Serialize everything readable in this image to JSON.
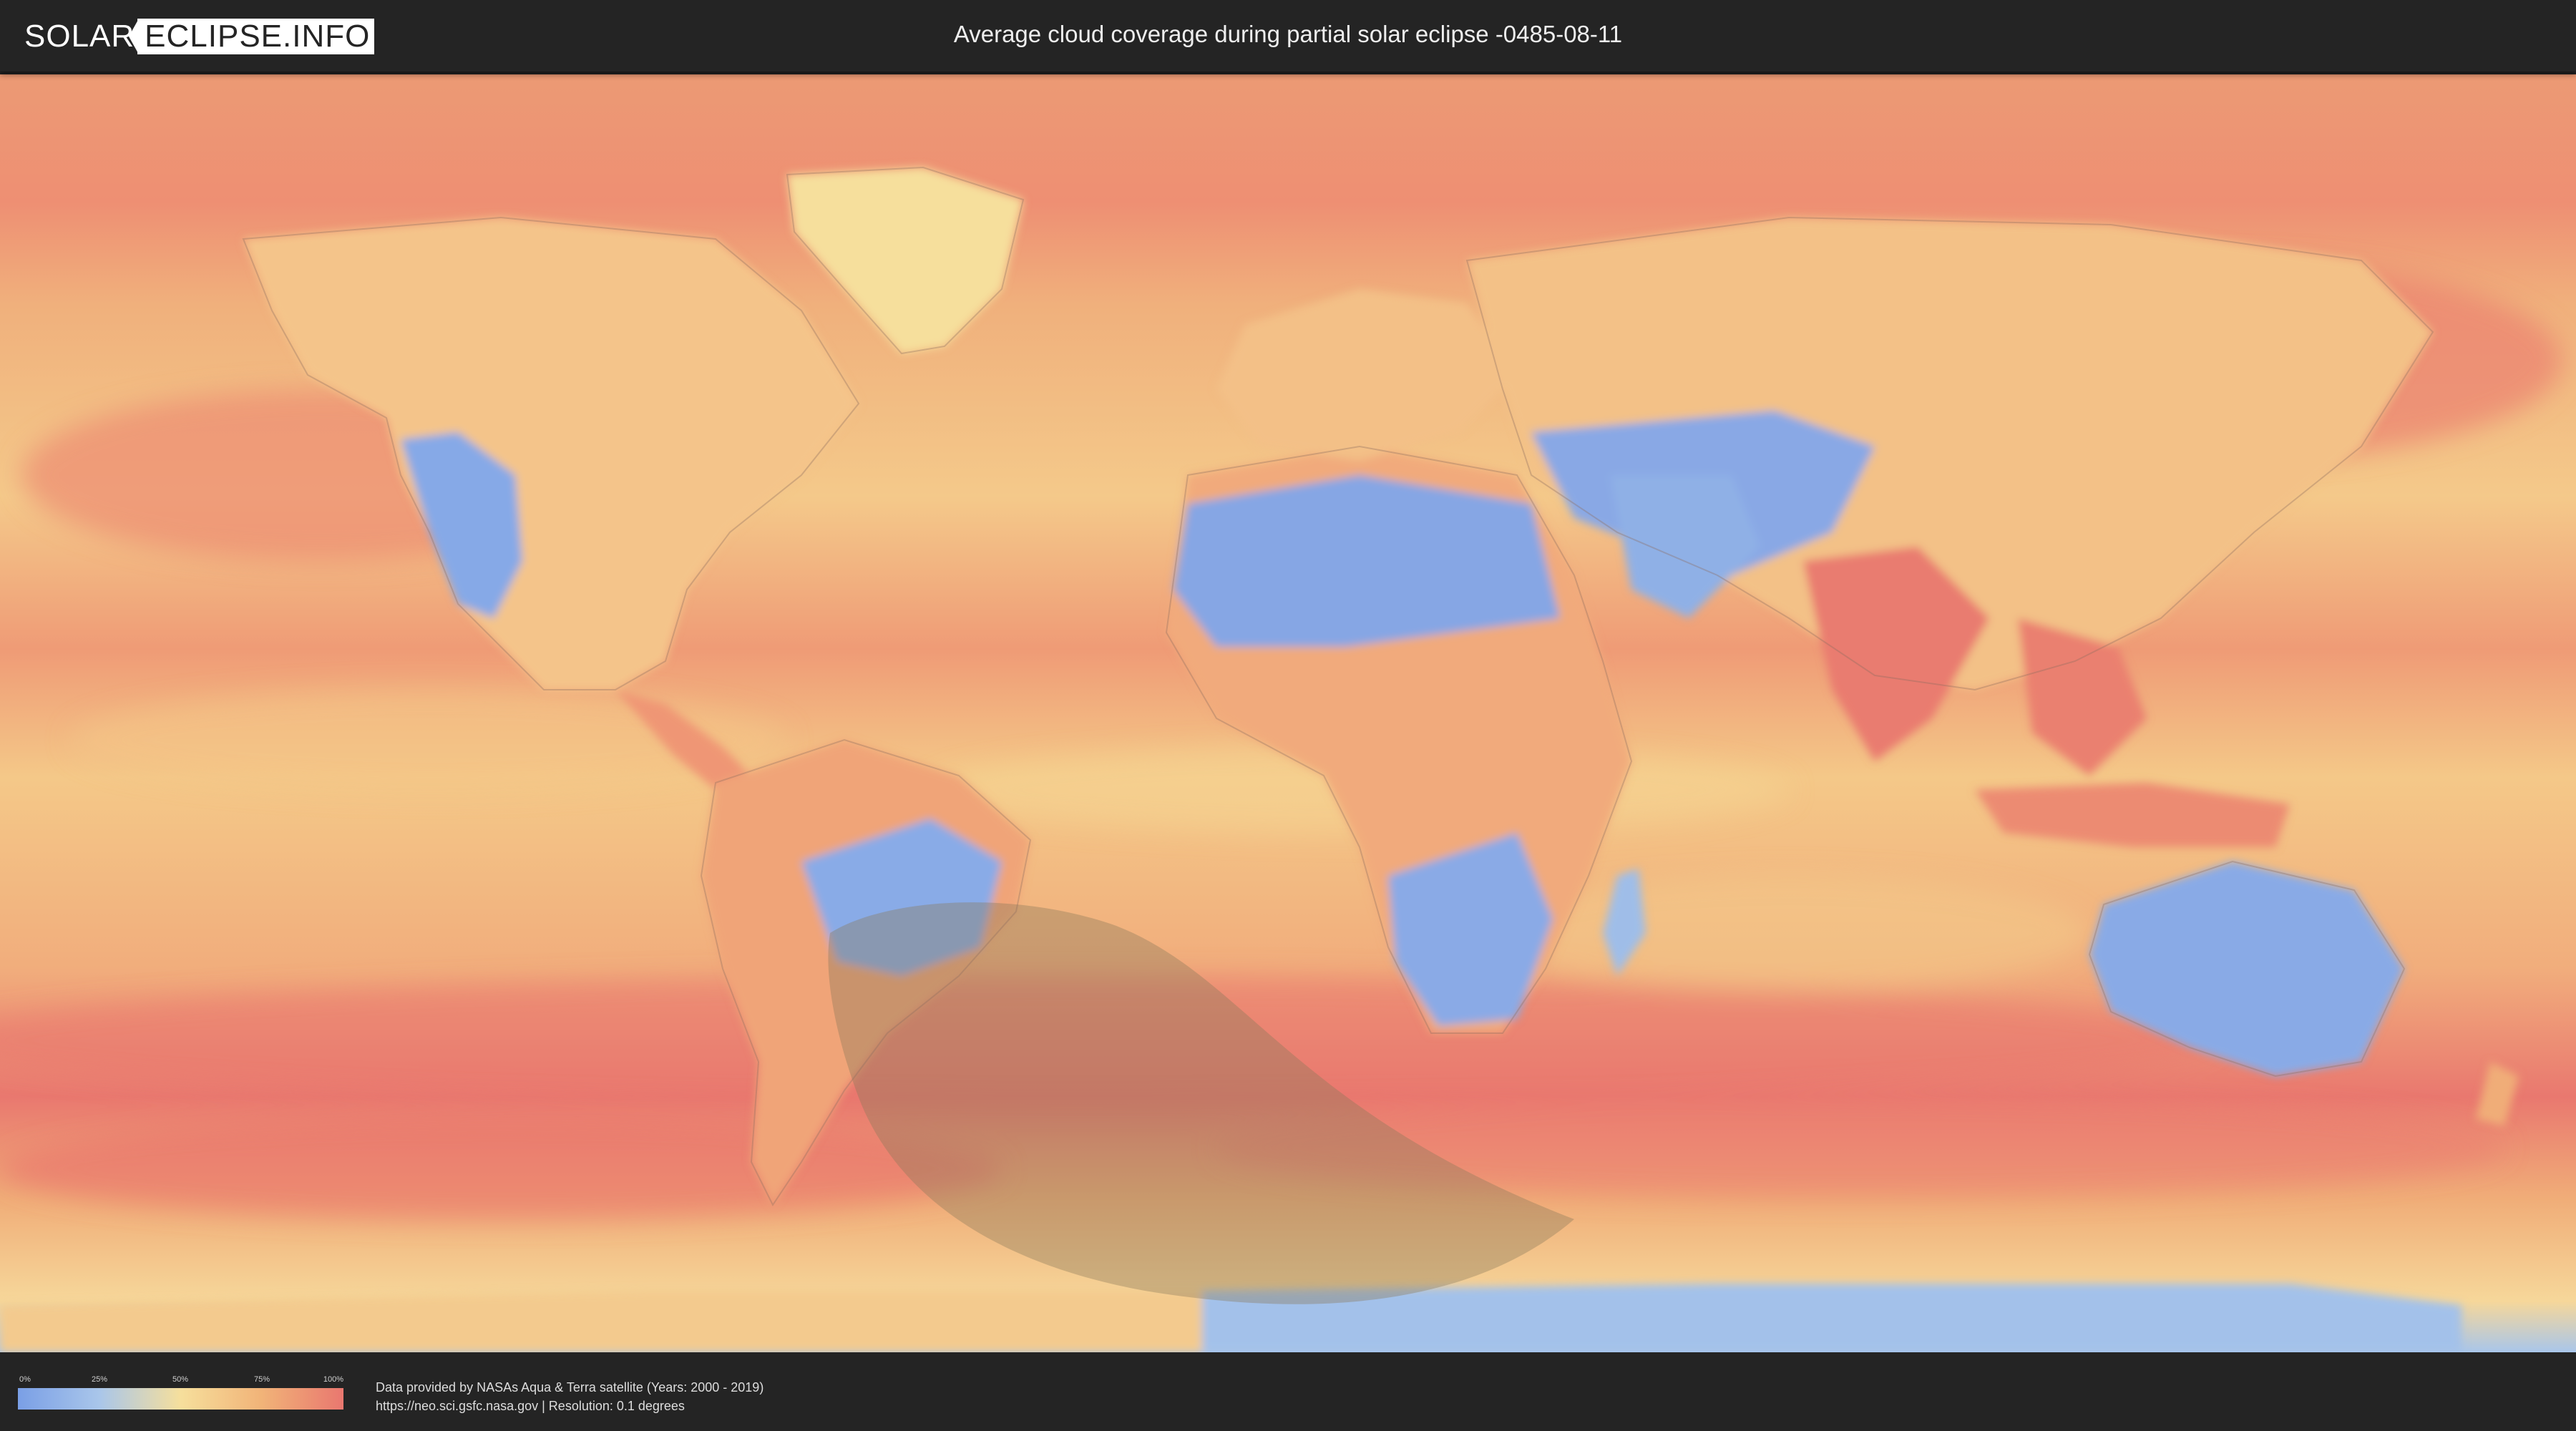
{
  "header": {
    "logo_left": "SOLAR",
    "logo_right": "ECLIPSE.INFO",
    "title": "Average cloud coverage during partial solar eclipse -0485-08-11"
  },
  "map": {
    "icon": "world-map-cloud-coverage",
    "colors": {
      "clear": "#7a9fe6",
      "low": "#a9c6ea",
      "mid": "#f6df9c",
      "high": "#f1b378",
      "overcast": "#e9776f",
      "eclipse_shadow": "#8a7a5a"
    }
  },
  "legend": {
    "ticks": [
      "0%",
      "25%",
      "50%",
      "75%",
      "100%"
    ],
    "colors": [
      "#7a9fe6",
      "#a9c6ea",
      "#f6df9c",
      "#f1b378",
      "#e9776f"
    ]
  },
  "footer": {
    "credit_line1": "Data provided by NASAs Aqua & Terra satellite (Years: 2000 - 2019)",
    "credit_line2": "https://neo.sci.gsfc.nasa.gov | Resolution: 0.1 degrees"
  }
}
